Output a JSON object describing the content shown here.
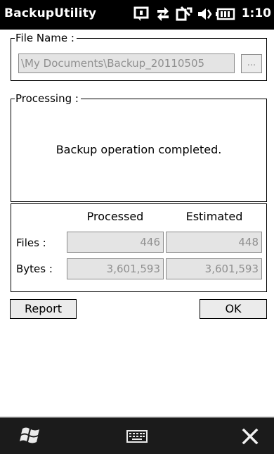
{
  "window": {
    "title": "BackupUtility",
    "clock": "1:10",
    "status_icons": [
      "notification-icon",
      "data-connection-icon",
      "signal-icon",
      "volume-icon",
      "battery-icon"
    ]
  },
  "file_group": {
    "legend": "File Name :",
    "path_value": "\\My Documents\\Backup_20110505",
    "browse_label": "..."
  },
  "processing_group": {
    "legend": "Processing :",
    "message": "Backup operation completed."
  },
  "stats": {
    "headers": {
      "processed": "Processed",
      "estimated": "Estimated"
    },
    "rows": [
      {
        "label": "Files :",
        "processed": "446",
        "estimated": "448"
      },
      {
        "label": "Bytes :",
        "processed": "3,601,593",
        "estimated": "3,601,593"
      }
    ]
  },
  "actions": {
    "report": "Report",
    "ok": "OK"
  },
  "taskbar": {
    "start_icon": "windows-start-icon",
    "keyboard_icon": "keyboard-icon",
    "close_icon": "close-icon"
  },
  "colors": {
    "titlebar": "#000000",
    "taskbar": "#1b1b1b",
    "field_bg": "#e4e4e4",
    "disabled_text": "#909090"
  }
}
